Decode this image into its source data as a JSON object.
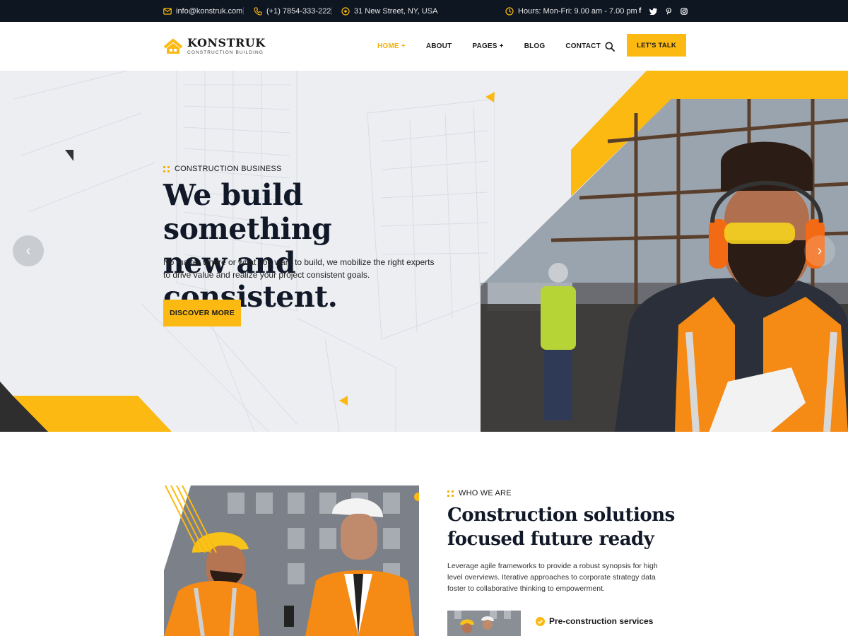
{
  "topbar": {
    "email": "info@konstruk.com",
    "phone": "(+1) 7854-333-222",
    "address": "31 New Street, NY, USA",
    "hours": "Hours: Mon-Fri: 9.00 am - 7.00 pm",
    "social": [
      "facebook-icon",
      "twitter-icon",
      "pinterest-icon",
      "instagram-icon"
    ]
  },
  "header": {
    "logo_name": "KONSTRUK",
    "logo_tagline": "CONSTRUCTION BUILDING",
    "nav": [
      "HOME +",
      "ABOUT",
      "PAGES +",
      "BLOG",
      "CONTACT"
    ],
    "active_nav": "HOME +",
    "cta_label": "LET'S TALK"
  },
  "hero": {
    "eyebrow": "CONSTRUCTION BUSINESS",
    "title_line1": "We build something",
    "title_line2": "new and consistent.",
    "text": "No matter where or what you want to build, we mobilize the right experts to drive value and realize your project consistent goals.",
    "button_label": "DISCOVER MORE",
    "prev_arrow": "‹",
    "next_arrow": "›"
  },
  "about": {
    "eyebrow": "WHO WE ARE",
    "title": "Construction solutions focused future ready",
    "text": "Leverage agile frameworks to provide a robust synopsis for high level overviews. Iterative approaches to corporate strategy data foster to collaborative thinking to empowerment.",
    "feature_label": "Pre-construction services"
  },
  "colors": {
    "accent": "#fbb911",
    "topbar_bg": "#0e1622",
    "heading": "#111827"
  }
}
